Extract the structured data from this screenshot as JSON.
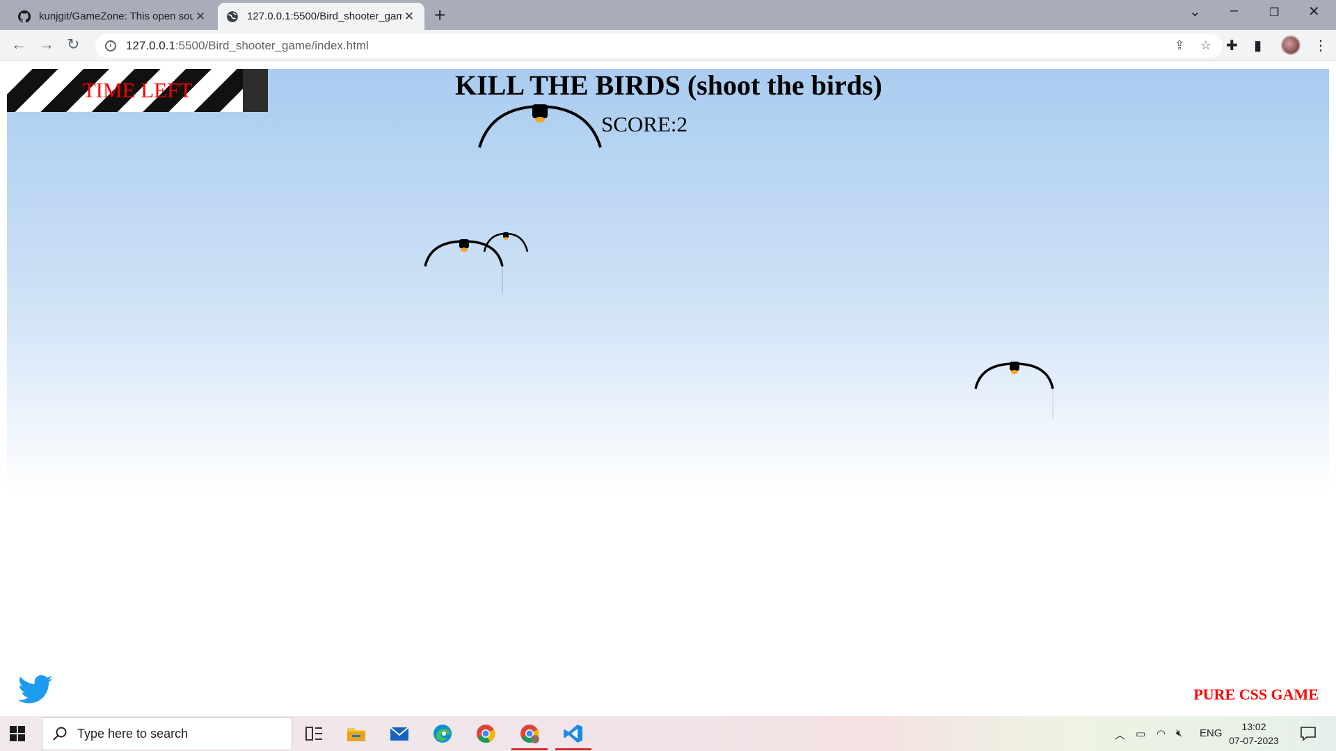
{
  "browser": {
    "tabs": [
      {
        "title": "kunjgit/GameZone: This open sou",
        "icon": "github-icon",
        "active": false
      },
      {
        "title": "127.0.0.1:5500/Bird_shooter_gam",
        "icon": "globe-icon",
        "active": true
      }
    ],
    "new_tab_label": "+",
    "address": {
      "host": "127.0.0.1",
      "rest": ":5500/Bird_shooter_game/index.html"
    }
  },
  "game": {
    "time_label": "TIME LEFT",
    "title": "KILL THE BIRDS (shoot the birds)",
    "score_text": "SCORE:2",
    "footer_label": "PURE CSS GAME",
    "colors": {
      "sky_top": "#a9ccf0",
      "timer_text": "#ff0000",
      "footer_text": "#ff0000",
      "twitter": "#1d9bf0"
    }
  },
  "taskbar": {
    "search_placeholder": "Type here to search",
    "language": "ENG",
    "time": "13:02",
    "date": "07-07-2023",
    "apps": [
      "task-view-icon",
      "file-explorer-icon",
      "mail-icon",
      "edge-icon",
      "chrome-icon",
      "chrome-profile-icon",
      "vscode-icon"
    ]
  }
}
